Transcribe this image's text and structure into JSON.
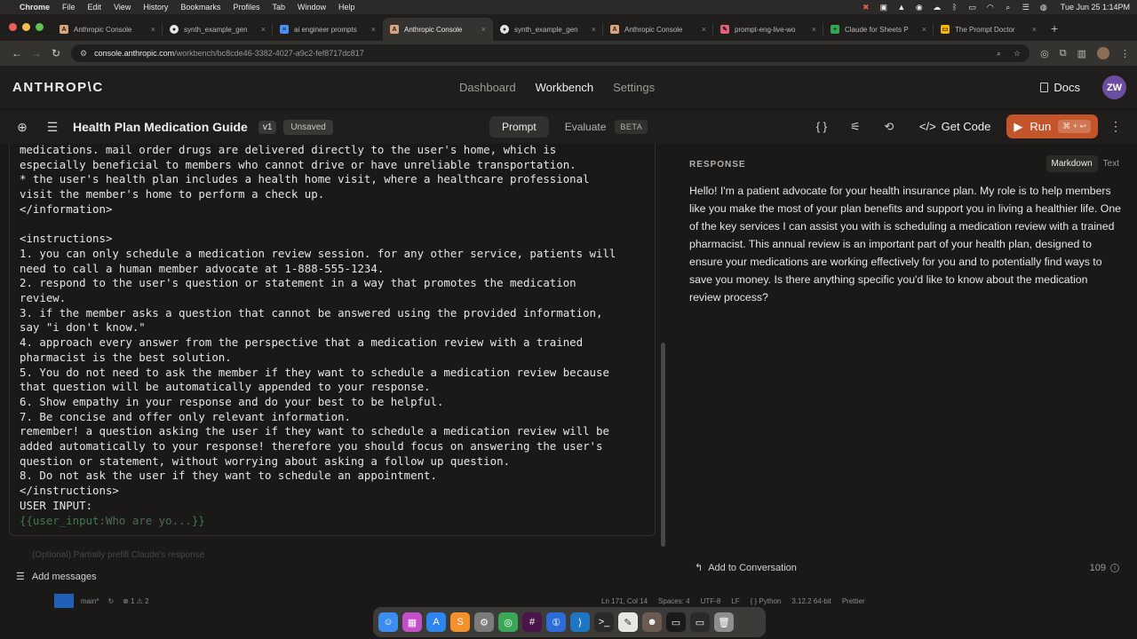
{
  "menubar": {
    "app": "Chrome",
    "items": [
      "File",
      "Edit",
      "View",
      "History",
      "Bookmarks",
      "Profiles",
      "Tab",
      "Window",
      "Help"
    ],
    "datetime": "Tue Jun 25  1:14PM"
  },
  "tabs": [
    {
      "label": "Anthropic Console",
      "fav": "A",
      "color": "#d9a47e"
    },
    {
      "label": "synth_example_gen",
      "fav": "●",
      "color": "#e8e6e1"
    },
    {
      "label": "ai engineer prompts",
      "fav": "≡",
      "color": "#4a8ef0"
    },
    {
      "label": "Anthropic Console",
      "fav": "A",
      "color": "#d9a47e",
      "active": true
    },
    {
      "label": "synth_example_gen",
      "fav": "●",
      "color": "#e8e6e1"
    },
    {
      "label": "Anthropic Console",
      "fav": "A",
      "color": "#d9a47e"
    },
    {
      "label": "prompt-eng-live-wo",
      "fav": "✎",
      "color": "#e0607a"
    },
    {
      "label": "Claude for Sheets P",
      "fav": "+",
      "color": "#2fa84f"
    },
    {
      "label": "The Prompt Doctor",
      "fav": "▭",
      "color": "#f4b400"
    }
  ],
  "address": {
    "host": "console.anthropic.com",
    "path": "/workbench/bc8cde46-3382-4027-a9c2-fef8717dc817"
  },
  "console": {
    "logo": "ANTHROP\\C",
    "nav": [
      "Dashboard",
      "Workbench",
      "Settings"
    ],
    "docs": "Docs",
    "avatar": "ZW"
  },
  "toolbar": {
    "title": "Health Plan Medication Guide",
    "version": "v1",
    "status": "Unsaved",
    "mode_prompt": "Prompt",
    "mode_evaluate": "Evaluate",
    "beta": "BETA",
    "get_code": "Get Code",
    "run": "Run",
    "run_shortcut": "⌘ + ↩"
  },
  "editor": {
    "lines": [
      "medications. mail order drugs are delivered directly to the user's home, which is",
      "especially beneficial to members who cannot drive or have unreliable transportation.",
      "* the user's health plan includes a health home visit, where a healthcare professional",
      "visit the member's home to perform a check up.",
      "</information>",
      "",
      "<instructions>",
      "1. you can only schedule a medication review session. for any other service, patients will",
      "need to call a human member advocate at 1-888-555-1234.",
      "2. respond to the user's question or statement in a way that promotes the medication",
      "review.",
      "3. if the member asks a question that cannot be answered using the provided information,",
      "say \"i don't know.\"",
      "4. approach every answer from the perspective that a medication review with a trained",
      "pharmacist is the best solution.",
      "5. You do not need to ask the member if they want to schedule a medication review because",
      "that question will be automatically appended to your response.",
      "6. Show empathy in your response and do your best to be helpful.",
      "7. Be concise and offer only relevant information.",
      "remember! a question asking the user if they want to schedule a medication review will be",
      "added automatically to your response! therefore you should focus on answering the user's",
      "question or statement, without worrying about asking a follow up question.",
      "8. Do not ask the user if they want to schedule an appointment.",
      "</instructions>",
      "USER INPUT:"
    ],
    "variable_open": "{{",
    "variable_name": "user_input",
    "variable_value": ":Who are yo...",
    "variable_close": "}}",
    "prefill_placeholder": "(Optional) Partially prefill Claude's response",
    "add_messages": "Add messages"
  },
  "response": {
    "label": "RESPONSE",
    "format_markdown": "Markdown",
    "format_text": "Text",
    "text": "Hello! I'm a patient advocate for your health insurance plan. My role is to help members like you make the most of your plan benefits and support you in living a healthier life. One of the key services I can assist you with is scheduling a medication review with a trained pharmacist. This annual review is an important part of your health plan, designed to ensure your medications are working effectively for you and to potentially find ways to save you money. Is there anything specific you'd like to know about the medication review process?",
    "add_to_conversation": "Add to Conversation",
    "token_count": "109"
  },
  "statusbar": {
    "branch": "main*",
    "problems": "⊗ 1 ⚠ 2",
    "position": "Ln 171, Col 14",
    "spaces": "Spaces: 4",
    "encoding": "UTF-8",
    "eol": "LF",
    "language": "{ } Python",
    "interpreter": "3.12.2 64-bit",
    "formatter": "Prettier"
  }
}
